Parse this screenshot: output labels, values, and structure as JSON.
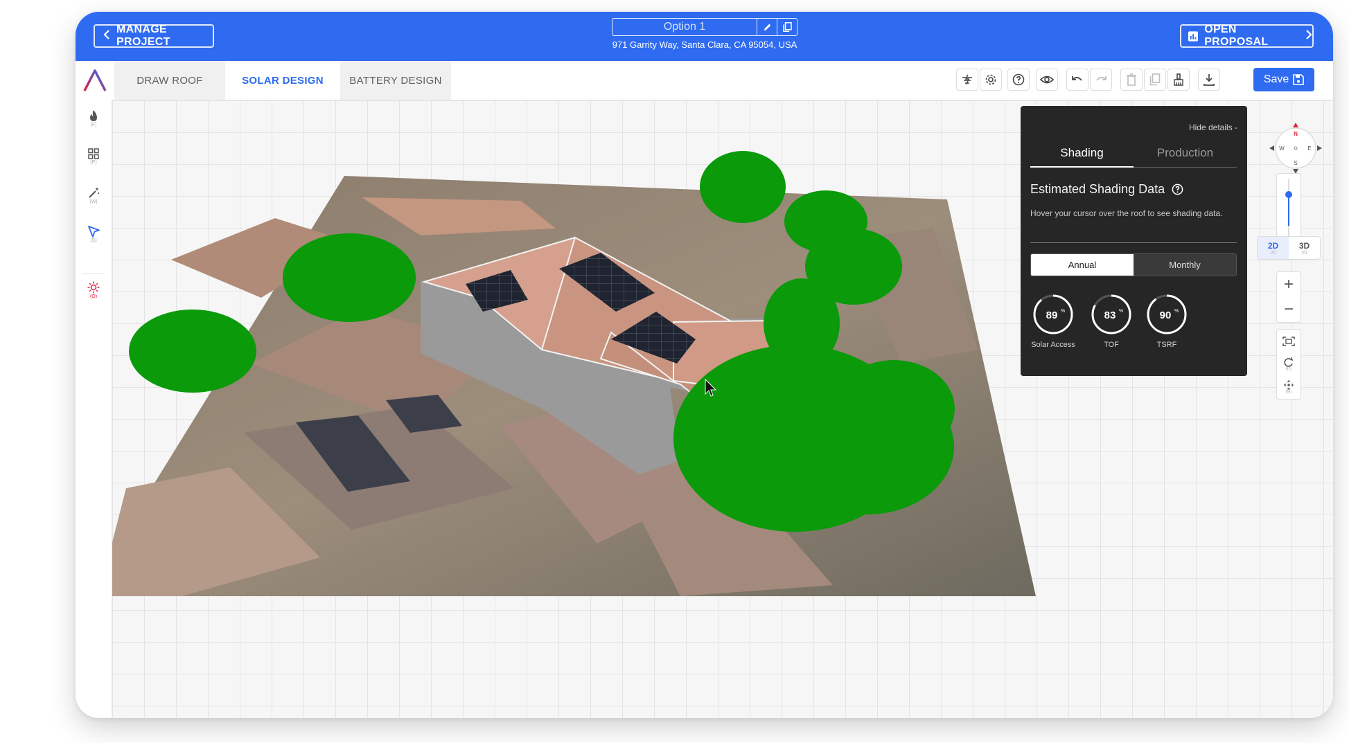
{
  "header": {
    "manage_project_label": "MANAGE PROJECT",
    "option_name": "Option 1",
    "address": "971 Garrity Way, Santa Clara, CA 95054, USA",
    "open_proposal_label": "OPEN PROPOSAL",
    "brand_color": "#2e6bf0"
  },
  "nav": {
    "tabs": [
      {
        "label": "DRAW ROOF",
        "active": false
      },
      {
        "label": "SOLAR DESIGN",
        "active": true
      },
      {
        "label": "BATTERY DESIGN",
        "active": false
      }
    ],
    "toolbar_icons": [
      "horizon-icon",
      "settings-icon",
      "help-icon",
      "view-icon",
      "undo-icon",
      "redo-icon",
      "delete-icon",
      "copy-icon",
      "clean-icon",
      "download-icon"
    ],
    "save_label": "Save"
  },
  "sidebar": {
    "items": [
      {
        "icon": "flame-icon",
        "hotkey": "(F)"
      },
      {
        "icon": "grid-icon",
        "hotkey": "(P)"
      },
      {
        "icon": "magic-wand-icon",
        "hotkey": "(W)"
      },
      {
        "icon": "cursor-icon",
        "hotkey": "(S)"
      },
      {
        "icon": "sun-icon",
        "hotkey": "(O)"
      }
    ]
  },
  "details_panel": {
    "hide_label": "Hide details -",
    "tabs": [
      "Shading",
      "Production"
    ],
    "active_tab": "Shading",
    "title": "Estimated Shading Data",
    "hint": "Hover your cursor over the roof to see shading data.",
    "period_options": [
      "Annual",
      "Monthly"
    ],
    "active_period": "Annual",
    "metrics": [
      {
        "label": "Solar Access",
        "value": "89",
        "percent": 89
      },
      {
        "label": "TOF",
        "value": "83",
        "percent": 83
      },
      {
        "label": "TSRF",
        "value": "90",
        "percent": 90
      }
    ]
  },
  "view_controls": {
    "compass": {
      "n": "N",
      "e": "E",
      "s": "S",
      "w": "W"
    },
    "view_modes": [
      "2D",
      "3D"
    ],
    "active_view": "2D",
    "view_hotkeys": [
      "(A)",
      "(A)"
    ],
    "zoom_in": "+",
    "zoom_out": "−",
    "tool_hotkeys": [
      "(R)",
      "(M)"
    ],
    "tree_color": "#0a9a0a"
  }
}
